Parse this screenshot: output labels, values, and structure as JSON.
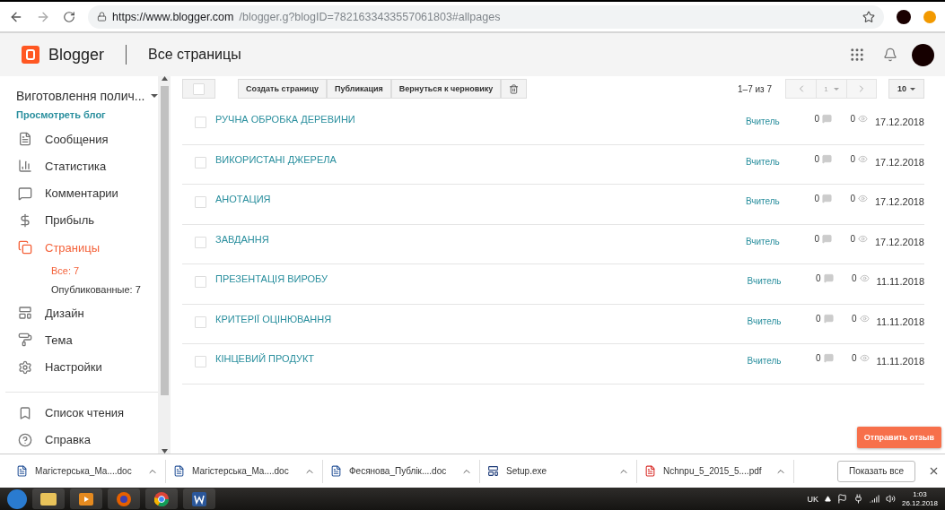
{
  "browser": {
    "url_host": "https://www.blogger.com",
    "url_path": "/blogger.g?blogID=7821633433557061803#allpages"
  },
  "header": {
    "brand": "Blogger",
    "page_title": "Все страницы"
  },
  "blog": {
    "name": "Виготовлення полич...",
    "view_link": "Просмотреть блог"
  },
  "sidebar": {
    "items": [
      {
        "label": "Сообщения",
        "selected": false
      },
      {
        "label": "Статистика",
        "selected": false
      },
      {
        "label": "Комментарии",
        "selected": false
      },
      {
        "label": "Прибыль",
        "selected": false
      },
      {
        "label": "Страницы",
        "selected": true,
        "children": [
          {
            "label": "Все: 7",
            "selected": true
          },
          {
            "label": "Опубликованные: 7",
            "selected": false
          }
        ]
      },
      {
        "label": "Дизайн",
        "selected": false
      },
      {
        "label": "Тема",
        "selected": false
      },
      {
        "label": "Настройки",
        "selected": false
      }
    ],
    "secondary_items": [
      {
        "label": "Список чтения"
      },
      {
        "label": "Справка"
      }
    ]
  },
  "toolbar": {
    "select_all_checked": false,
    "buttons": [
      "Создать страницу",
      "Публикация",
      "Вернуться к черновику"
    ]
  },
  "pagination": {
    "range": "1–7 из 7",
    "page": "1",
    "per_page": "10"
  },
  "rows": [
    {
      "title": "РУЧНА ОБРОБКА ДЕРЕВИНИ",
      "checked": false,
      "author": "Вчитель",
      "comments": "0",
      "views": "0",
      "date": "17.12.2018"
    },
    {
      "title": "ВИКОРИСТАНІ ДЖЕРЕЛА",
      "checked": false,
      "author": "Вчитель",
      "comments": "0",
      "views": "0",
      "date": "17.12.2018"
    },
    {
      "title": "АНОТАЦИЯ",
      "checked": false,
      "author": "Вчитель",
      "comments": "0",
      "views": "0",
      "date": "17.12.2018"
    },
    {
      "title": "ЗАВДАННЯ",
      "checked": false,
      "author": "Вчитель",
      "comments": "0",
      "views": "0",
      "date": "17.12.2018"
    },
    {
      "title": "ПРЕЗЕНТАЦІЯ ВИРОБУ",
      "checked": false,
      "author": "Вчитель",
      "comments": "0",
      "views": "0",
      "date": "11.11.2018"
    },
    {
      "title": "КРИТЕРІЇ ОЦІНЮВАННЯ",
      "checked": false,
      "author": "Вчитель",
      "comments": "0",
      "views": "0",
      "date": "11.11.2018"
    },
    {
      "title": "КІНЦЕВИЙ ПРОДУКТ",
      "checked": false,
      "author": "Вчитель",
      "comments": "0",
      "views": "0",
      "date": "11.11.2018"
    }
  ],
  "feedback_button": "Отправить отзыв",
  "downloads": {
    "items": [
      {
        "name": "Магістерська_Ма....doc",
        "kind": "doc"
      },
      {
        "name": "Магістерська_Ма....doc",
        "kind": "doc"
      },
      {
        "name": "Фесянова_Публік....doc",
        "kind": "doc"
      },
      {
        "name": "Setup.exe",
        "kind": "exe"
      },
      {
        "name": "Nchnpu_5_2015_5....pdf",
        "kind": "pdf"
      }
    ],
    "show_all": "Показать все"
  },
  "taskbar": {
    "language": "UK",
    "time": "1:03",
    "date": "26.12.2018"
  }
}
